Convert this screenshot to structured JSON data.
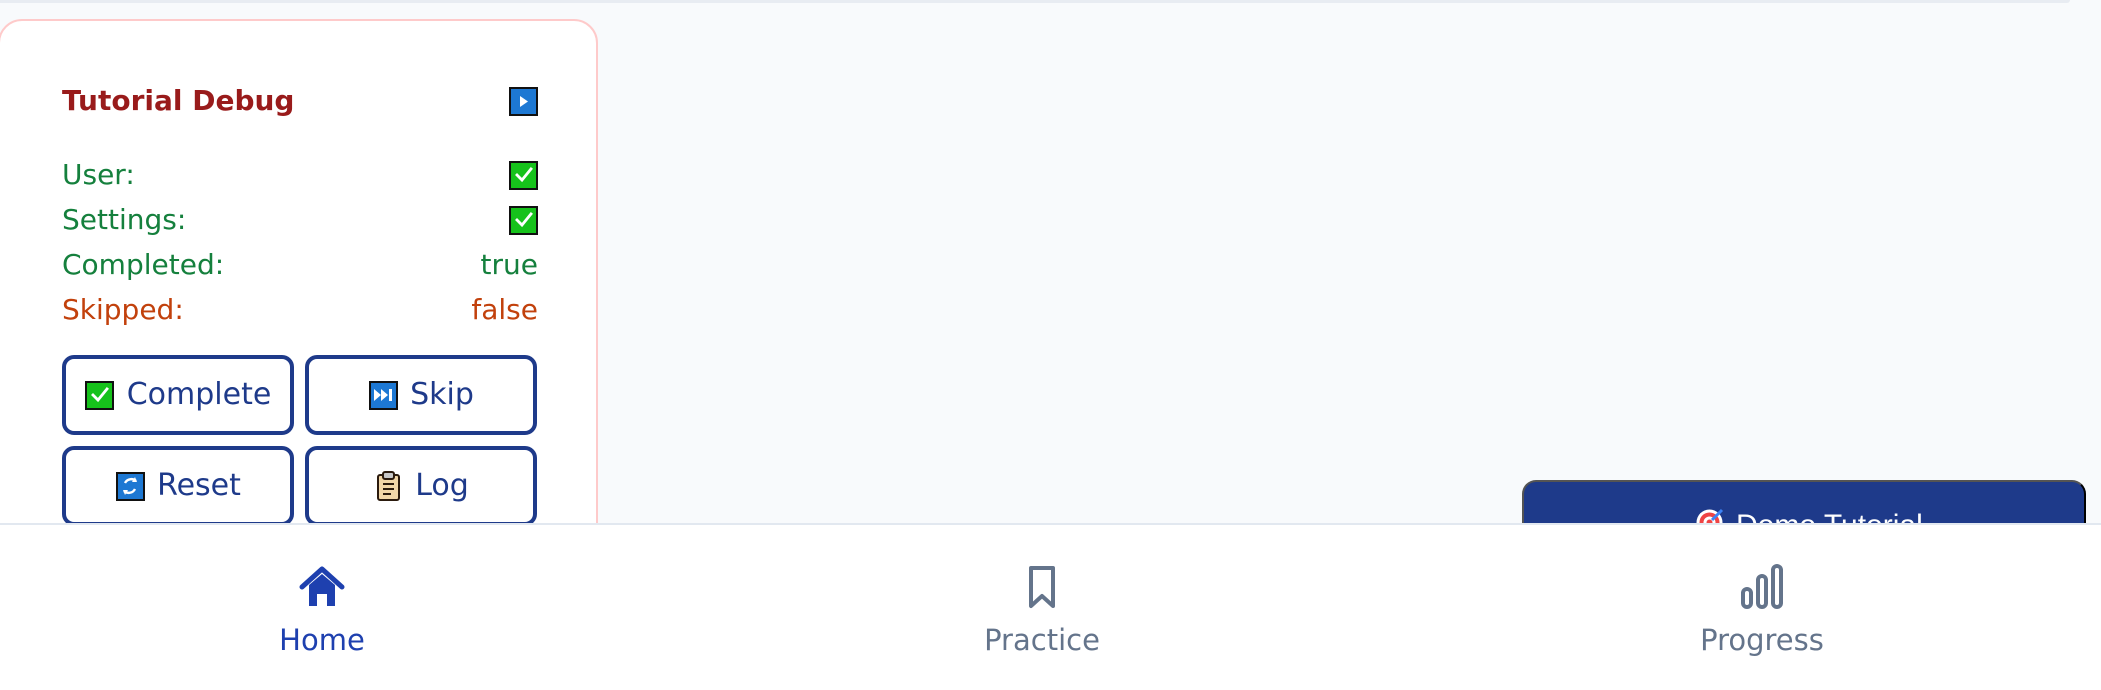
{
  "debug_panel": {
    "title": "Tutorial Debug",
    "status_icon": "play-button-icon",
    "rows": {
      "user": {
        "label": "User:",
        "value_icon": "check-mark-icon"
      },
      "settings": {
        "label": "Settings:",
        "value_icon": "check-mark-icon"
      },
      "completed": {
        "label": "Completed:",
        "value": "true"
      },
      "skipped": {
        "label": "Skipped:",
        "value": "false"
      }
    },
    "buttons": {
      "complete": {
        "label": "Complete",
        "icon": "check-mark-icon"
      },
      "skip": {
        "label": "Skip",
        "icon": "fast-forward-icon"
      },
      "reset": {
        "label": "Reset",
        "icon": "refresh-icon"
      },
      "log": {
        "label": "Log",
        "icon": "clipboard-icon"
      }
    }
  },
  "demo_tutorial": {
    "label": "Demo Tutorial",
    "icon": "target-icon"
  },
  "bottom_nav": {
    "items": [
      {
        "label": "Home",
        "icon": "home-icon",
        "active": true
      },
      {
        "label": "Practice",
        "icon": "bookmark-icon",
        "active": false
      },
      {
        "label": "Progress",
        "icon": "bar-chart-icon",
        "active": false
      }
    ]
  },
  "colors": {
    "navy": "#1e3a8a",
    "debug_red": "#991b1b",
    "success_green": "#15803d",
    "warning_orange": "#c2410c",
    "danger_red": "#dc2626",
    "muted_gray": "#64748b",
    "background": "#f8fafc"
  }
}
